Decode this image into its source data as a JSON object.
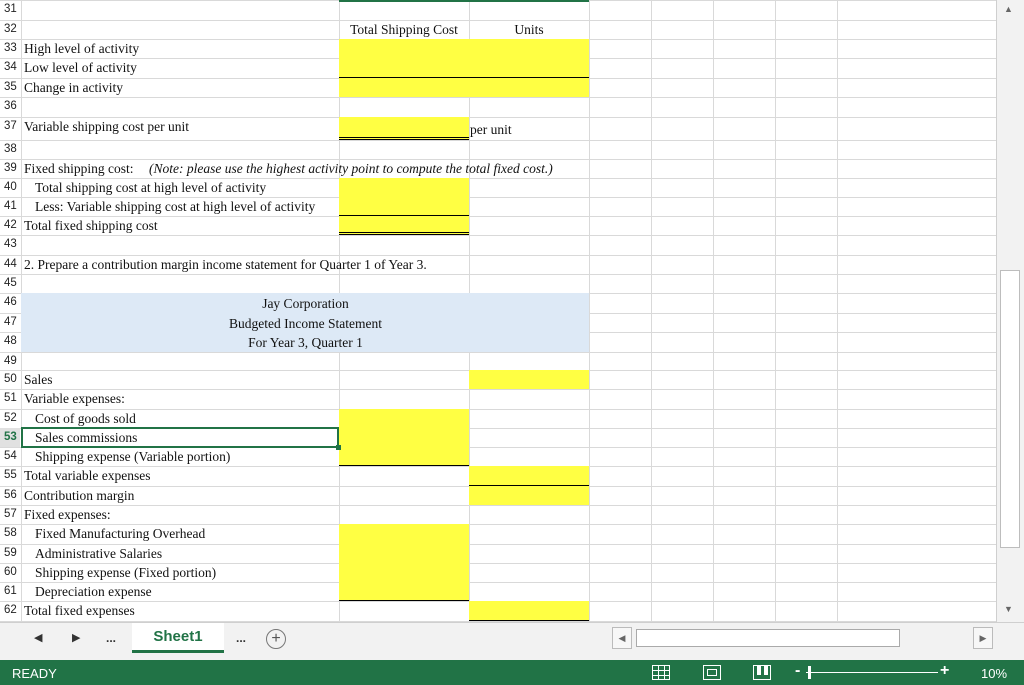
{
  "rows": [
    {
      "num": "31",
      "a": "",
      "indent": false
    },
    {
      "num": "32",
      "a": "",
      "indent": false
    },
    {
      "num": "33",
      "a": "High level of activity",
      "indent": false
    },
    {
      "num": "34",
      "a": "Low level of activity",
      "indent": false
    },
    {
      "num": "35",
      "a": "Change in activity",
      "indent": false
    },
    {
      "num": "36",
      "a": "",
      "indent": false
    },
    {
      "num": "37",
      "a": "Variable shipping cost per unit",
      "indent": false
    },
    {
      "num": "38",
      "a": "",
      "indent": false
    },
    {
      "num": "39",
      "a": "Fixed shipping cost:",
      "indent": false
    },
    {
      "num": "40",
      "a": "Total shipping cost at high level of activity",
      "indent": true
    },
    {
      "num": "41",
      "a": "Less: Variable shipping cost at high level of activity",
      "indent": true
    },
    {
      "num": "42",
      "a": "Total fixed shipping cost",
      "indent": false
    },
    {
      "num": "43",
      "a": "",
      "indent": false
    },
    {
      "num": "44",
      "a": "2. Prepare a contribution margin income statement for Quarter 1 of Year 3.",
      "indent": false
    },
    {
      "num": "45",
      "a": "",
      "indent": false
    },
    {
      "num": "46",
      "a": "",
      "indent": false
    },
    {
      "num": "47",
      "a": "",
      "indent": false
    },
    {
      "num": "48",
      "a": "",
      "indent": false
    },
    {
      "num": "49",
      "a": "",
      "indent": false
    },
    {
      "num": "50",
      "a": "Sales",
      "indent": false
    },
    {
      "num": "51",
      "a": "Variable expenses:",
      "indent": false
    },
    {
      "num": "52",
      "a": "Cost of goods sold",
      "indent": true
    },
    {
      "num": "53",
      "a": "Sales commissions",
      "indent": true
    },
    {
      "num": "54",
      "a": "Shipping expense (Variable portion)",
      "indent": true
    },
    {
      "num": "55",
      "a": "Total variable expenses",
      "indent": false
    },
    {
      "num": "56",
      "a": "Contribution margin",
      "indent": false
    },
    {
      "num": "57",
      "a": "Fixed expenses:",
      "indent": false
    },
    {
      "num": "58",
      "a": "Fixed Manufacturing Overhead",
      "indent": true
    },
    {
      "num": "59",
      "a": "Administrative Salaries",
      "indent": true
    },
    {
      "num": "60",
      "a": "Shipping expense (Fixed portion)",
      "indent": true
    },
    {
      "num": "61",
      "a": "Depreciation expense",
      "indent": true
    },
    {
      "num": "62",
      "a": "Total fixed expenses",
      "indent": false
    }
  ],
  "headers": {
    "total_shipping_cost": "Total Shipping Cost",
    "units": "Units"
  },
  "per_unit": "per unit",
  "note": "(Note: please use the highest activity point to compute the total fixed cost.)",
  "statement": {
    "company": "Jay Corporation",
    "title": "Budgeted Income Statement",
    "period": "For Year 3, Quarter 1"
  },
  "selected_row": "53",
  "tabs": {
    "sheet": "Sheet1",
    "ellipsis_left": "...",
    "ellipsis_right": "...",
    "add": "+"
  },
  "status": {
    "ready": "READY",
    "zoom": "10%"
  },
  "colors": {
    "input": "#ffff43",
    "header_band": "#dde9f6",
    "status_bar": "#217346"
  }
}
